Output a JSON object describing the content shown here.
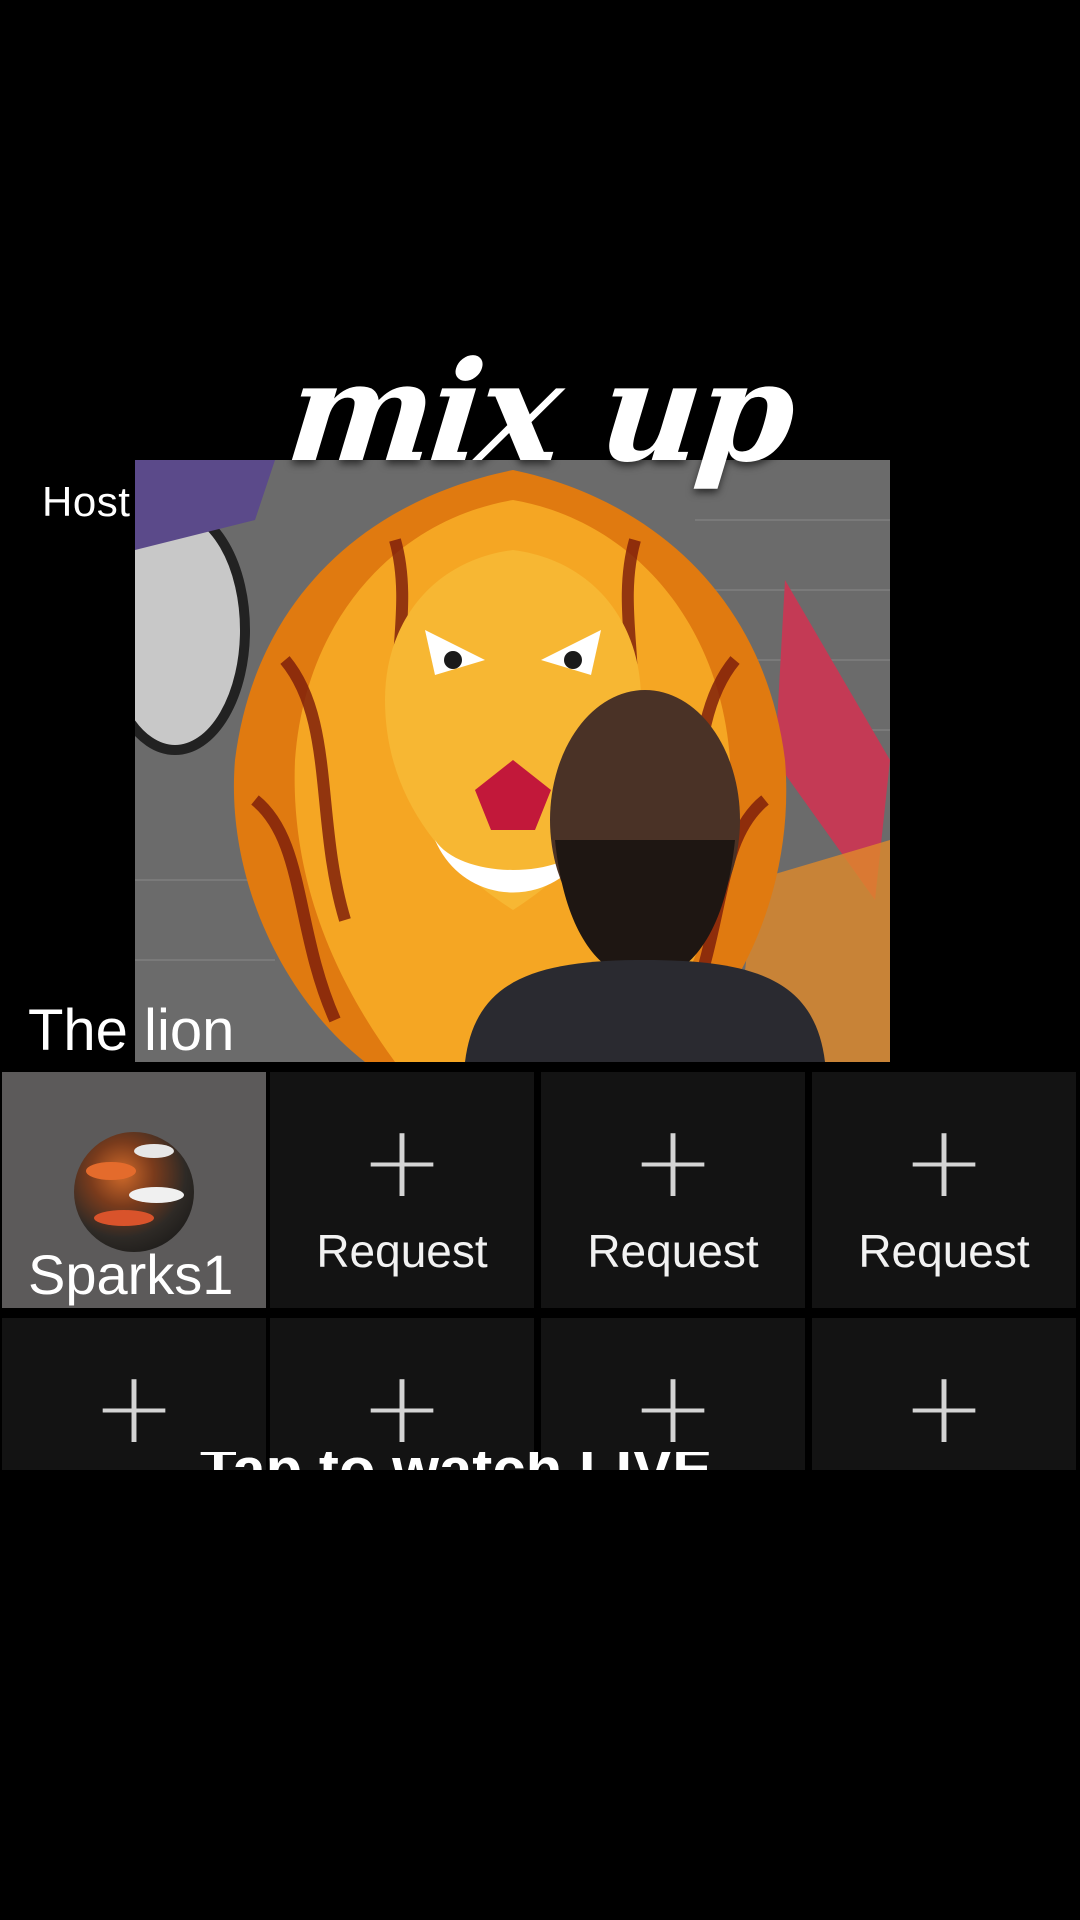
{
  "title": "mix up",
  "host": {
    "label": "Host",
    "name": "The lion"
  },
  "guest_slots": [
    {
      "occupied": true,
      "name": "Sparks1"
    },
    {
      "occupied": false,
      "label": "Request"
    },
    {
      "occupied": false,
      "label": "Request"
    },
    {
      "occupied": false,
      "label": "Request"
    },
    {
      "occupied": false,
      "label": ""
    },
    {
      "occupied": false,
      "label": ""
    },
    {
      "occupied": false,
      "label": ""
    },
    {
      "occupied": false,
      "label": ""
    }
  ],
  "hint": "Tap to watch LIVE",
  "colors": {
    "background": "#000000",
    "empty_slot": "#131313",
    "occupied_slot": "#5c5a5a"
  }
}
